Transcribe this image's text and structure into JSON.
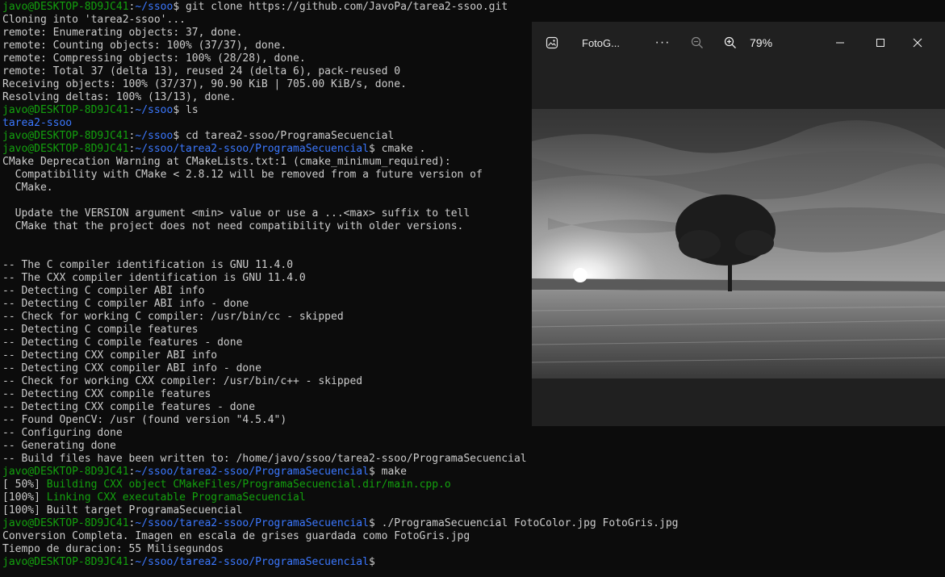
{
  "terminal": {
    "lines": [
      [
        {
          "t": "javo@DESKTOP-8D9JC41",
          "c": "g"
        },
        {
          "t": ":",
          "c": "w"
        },
        {
          "t": "~/ssoo",
          "c": "b"
        },
        {
          "t": "$ git clone https://github.com/JavoPa/tarea2-ssoo.git",
          "c": "w"
        }
      ],
      [
        {
          "t": "Cloning into 'tarea2-ssoo'...",
          "c": "w"
        }
      ],
      [
        {
          "t": "remote: Enumerating objects: 37, done.",
          "c": "w"
        }
      ],
      [
        {
          "t": "remote: Counting objects: 100% (37/37), done.",
          "c": "w"
        }
      ],
      [
        {
          "t": "remote: Compressing objects: 100% (28/28), done.",
          "c": "w"
        }
      ],
      [
        {
          "t": "remote: Total 37 (delta 13), reused 24 (delta 6), pack-reused 0",
          "c": "w"
        }
      ],
      [
        {
          "t": "Receiving objects: 100% (37/37), 90.90 KiB | 705.00 KiB/s, done.",
          "c": "w"
        }
      ],
      [
        {
          "t": "Resolving deltas: 100% (13/13), done.",
          "c": "w"
        }
      ],
      [
        {
          "t": "javo@DESKTOP-8D9JC41",
          "c": "g"
        },
        {
          "t": ":",
          "c": "w"
        },
        {
          "t": "~/ssoo",
          "c": "b"
        },
        {
          "t": "$ ls",
          "c": "w"
        }
      ],
      [
        {
          "t": "tarea2-ssoo",
          "c": "b"
        }
      ],
      [
        {
          "t": "javo@DESKTOP-8D9JC41",
          "c": "g"
        },
        {
          "t": ":",
          "c": "w"
        },
        {
          "t": "~/ssoo",
          "c": "b"
        },
        {
          "t": "$ cd tarea2-ssoo/ProgramaSecuencial",
          "c": "w"
        }
      ],
      [
        {
          "t": "javo@DESKTOP-8D9JC41",
          "c": "g"
        },
        {
          "t": ":",
          "c": "w"
        },
        {
          "t": "~/ssoo/tarea2-ssoo/ProgramaSecuencial",
          "c": "b"
        },
        {
          "t": "$ cmake .",
          "c": "w"
        }
      ],
      [
        {
          "t": "CMake Deprecation Warning at CMakeLists.txt:1 (cmake_minimum_required):",
          "c": "w"
        }
      ],
      [
        {
          "t": "  Compatibility with CMake < 2.8.12 will be removed from a future version of",
          "c": "w"
        }
      ],
      [
        {
          "t": "  CMake.",
          "c": "w"
        }
      ],
      [
        {
          "t": "",
          "c": "w"
        }
      ],
      [
        {
          "t": "  Update the VERSION argument <min> value or use a ...<max> suffix to tell",
          "c": "w"
        }
      ],
      [
        {
          "t": "  CMake that the project does not need compatibility with older versions.",
          "c": "w"
        }
      ],
      [
        {
          "t": "",
          "c": "w"
        }
      ],
      [
        {
          "t": "",
          "c": "w"
        }
      ],
      [
        {
          "t": "-- The C compiler identification is GNU 11.4.0",
          "c": "w"
        }
      ],
      [
        {
          "t": "-- The CXX compiler identification is GNU 11.4.0",
          "c": "w"
        }
      ],
      [
        {
          "t": "-- Detecting C compiler ABI info",
          "c": "w"
        }
      ],
      [
        {
          "t": "-- Detecting C compiler ABI info - done",
          "c": "w"
        }
      ],
      [
        {
          "t": "-- Check for working C compiler: /usr/bin/cc - skipped",
          "c": "w"
        }
      ],
      [
        {
          "t": "-- Detecting C compile features",
          "c": "w"
        }
      ],
      [
        {
          "t": "-- Detecting C compile features - done",
          "c": "w"
        }
      ],
      [
        {
          "t": "-- Detecting CXX compiler ABI info",
          "c": "w"
        }
      ],
      [
        {
          "t": "-- Detecting CXX compiler ABI info - done",
          "c": "w"
        }
      ],
      [
        {
          "t": "-- Check for working CXX compiler: /usr/bin/c++ - skipped",
          "c": "w"
        }
      ],
      [
        {
          "t": "-- Detecting CXX compile features",
          "c": "w"
        }
      ],
      [
        {
          "t": "-- Detecting CXX compile features - done",
          "c": "w"
        }
      ],
      [
        {
          "t": "-- Found OpenCV: /usr (found version \"4.5.4\")",
          "c": "w"
        }
      ],
      [
        {
          "t": "-- Configuring done",
          "c": "w"
        }
      ],
      [
        {
          "t": "-- Generating done",
          "c": "w"
        }
      ],
      [
        {
          "t": "-- Build files have been written to: /home/javo/ssoo/tarea2-ssoo/ProgramaSecuencial",
          "c": "w"
        }
      ],
      [
        {
          "t": "javo@DESKTOP-8D9JC41",
          "c": "g"
        },
        {
          "t": ":",
          "c": "w"
        },
        {
          "t": "~/ssoo/tarea2-ssoo/ProgramaSecuencial",
          "c": "b"
        },
        {
          "t": "$ make",
          "c": "w"
        }
      ],
      [
        {
          "t": "[ 50%] ",
          "c": "w"
        },
        {
          "t": "Building CXX object CMakeFiles/ProgramaSecuencial.dir/main.cpp.o",
          "c": "g"
        }
      ],
      [
        {
          "t": "[100%] ",
          "c": "w"
        },
        {
          "t": "Linking CXX executable ProgramaSecuencial",
          "c": "g"
        }
      ],
      [
        {
          "t": "[100%] Built target ProgramaSecuencial",
          "c": "w"
        }
      ],
      [
        {
          "t": "javo@DESKTOP-8D9JC41",
          "c": "g"
        },
        {
          "t": ":",
          "c": "w"
        },
        {
          "t": "~/ssoo/tarea2-ssoo/ProgramaSecuencial",
          "c": "b"
        },
        {
          "t": "$ ./ProgramaSecuencial FotoColor.jpg FotoGris.jpg",
          "c": "w"
        }
      ],
      [
        {
          "t": "Conversion Completa. Imagen en escala de grises guardada como FotoGris.jpg",
          "c": "w"
        }
      ],
      [
        {
          "t": "Tiempo de duracion: 55 Milisegundos",
          "c": "w"
        }
      ],
      [
        {
          "t": "javo@DESKTOP-8D9JC41",
          "c": "g"
        },
        {
          "t": ":",
          "c": "w"
        },
        {
          "t": "~/ssoo/tarea2-ssoo/ProgramaSecuencial",
          "c": "b"
        },
        {
          "t": "$",
          "c": "w"
        }
      ]
    ]
  },
  "viewer": {
    "file_name": "FotoG...",
    "more_label": "···",
    "zoom_level": "79%",
    "icons": {
      "app": "photos-app-icon",
      "zoom_out": "zoom-out-icon",
      "zoom_in": "zoom-in-icon",
      "minimize": "minimize-icon",
      "maximize": "maximize-icon",
      "close": "close-icon"
    }
  },
  "colors": {
    "terminal_bg": "#0c0c0c",
    "text": "#cccccc",
    "user_host": "#13a10e",
    "path": "#3b78ff",
    "viewer_bg": "#202020"
  }
}
